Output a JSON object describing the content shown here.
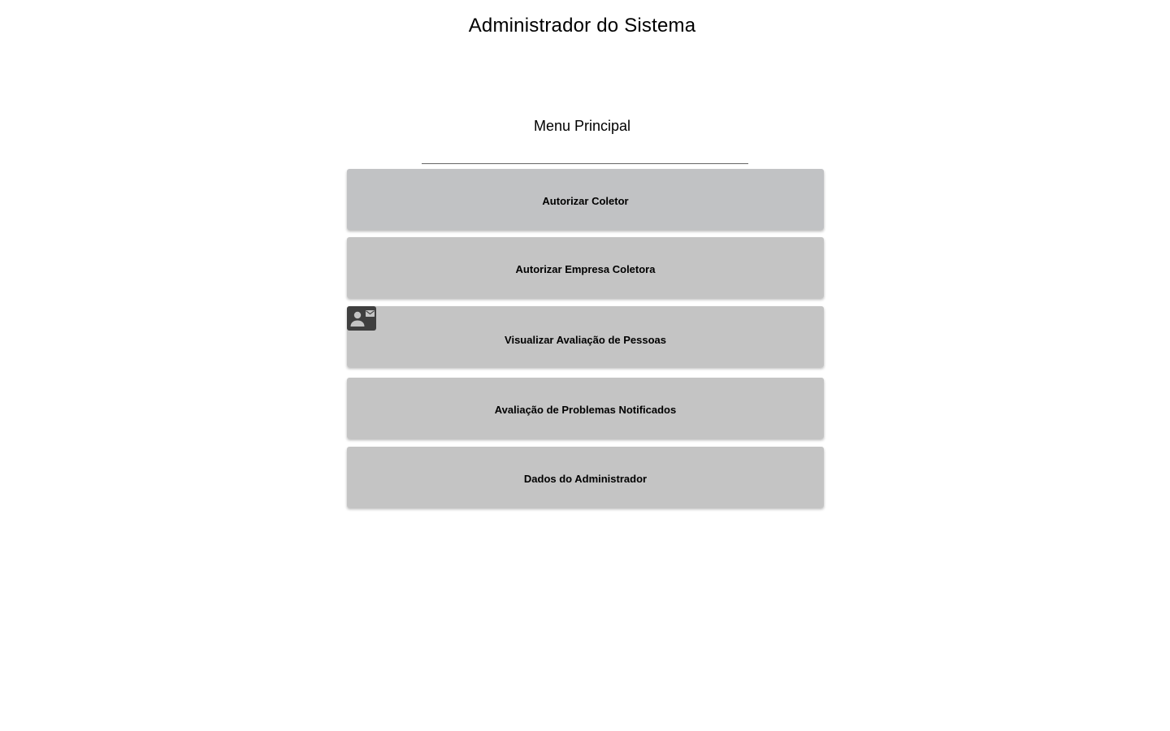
{
  "header": {
    "title": "Administrador do Sistema"
  },
  "menu": {
    "title": "Menu Principal",
    "items": [
      {
        "label": "Autorizar Coletor"
      },
      {
        "label": "Autorizar Empresa Coletora"
      },
      {
        "label": "Visualizar Avaliação de Pessoas",
        "icon": "contact-mail-icon"
      },
      {
        "label": "Avaliação de Problemas Notificados"
      },
      {
        "label": "Dados do Administrador"
      }
    ]
  },
  "colors": {
    "button_background": "#c4c4c4",
    "icon_badge_background": "#3f3f3f",
    "divider": "#666666"
  }
}
